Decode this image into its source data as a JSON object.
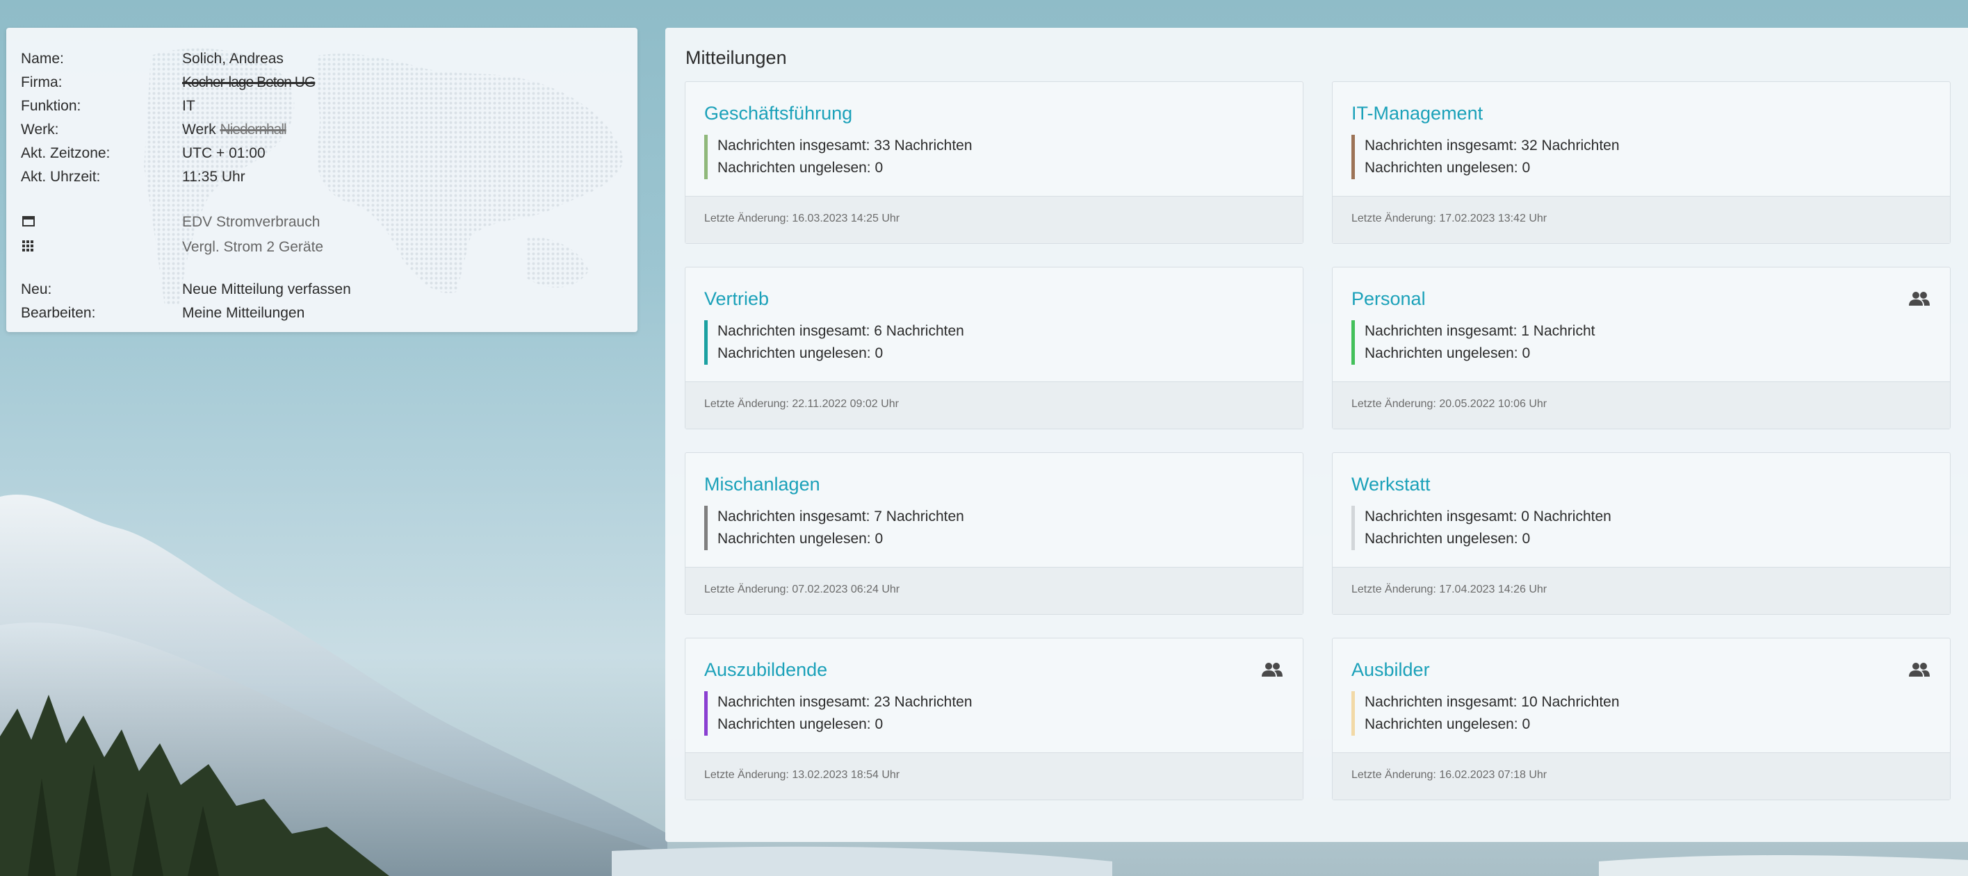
{
  "user_info": {
    "rows": [
      {
        "label": "Name:",
        "value": "Solich, Andreas"
      },
      {
        "label": "Firma:",
        "value": "Kocher-lage Beton UG"
      },
      {
        "label": "Funktion:",
        "value": "IT"
      },
      {
        "label": "Werk:",
        "value": "Werk ",
        "value_redacted": "Niedernhall"
      },
      {
        "label": "Akt. Zeitzone:",
        "value": "UTC + 01:00"
      },
      {
        "label": "Akt. Uhrzeit:",
        "value": "11:35 Uhr"
      }
    ],
    "links": [
      {
        "icon": "calendar-icon",
        "label": "EDV Stromverbrauch"
      },
      {
        "icon": "grid-icon",
        "label": "Vergl. Strom 2 Geräte"
      }
    ],
    "actions": [
      {
        "label": "Neu:",
        "value": "Neue Mitteilung verfassen"
      },
      {
        "label": "Bearbeiten:",
        "value": "Meine Mitteilungen"
      }
    ]
  },
  "main": {
    "title": "Mitteilungen",
    "cards": [
      {
        "title": "Geschäftsführung",
        "total": "Nachrichten insgesamt: 33 Nachrichten",
        "unread": "Nachrichten ungelesen: 0",
        "footer": "Letzte Änderung: 16.03.2023 14:25 Uhr",
        "color": "#8fb87a",
        "group": false
      },
      {
        "title": "IT-Management",
        "total": "Nachrichten insgesamt: 32 Nachrichten",
        "unread": "Nachrichten ungelesen: 0",
        "footer": "Letzte Änderung: 17.02.2023 13:42 Uhr",
        "color": "#9c7356",
        "group": false
      },
      {
        "title": "Vertrieb",
        "total": "Nachrichten insgesamt: 6 Nachrichten",
        "unread": "Nachrichten ungelesen: 0",
        "footer": "Letzte Änderung: 22.11.2022 09:02 Uhr",
        "color": "#1ba1a1",
        "group": false
      },
      {
        "title": "Personal",
        "total": "Nachrichten insgesamt: 1 Nachricht",
        "unread": "Nachrichten ungelesen: 0",
        "footer": "Letzte Änderung: 20.05.2022 10:06 Uhr",
        "color": "#43c05a",
        "group": true
      },
      {
        "title": "Mischanlagen",
        "total": "Nachrichten insgesamt: 7 Nachrichten",
        "unread": "Nachrichten ungelesen: 0",
        "footer": "Letzte Änderung: 07.02.2023 06:24 Uhr",
        "color": "#7f7f7f",
        "group": false
      },
      {
        "title": "Werkstatt",
        "total": "Nachrichten insgesamt: 0 Nachrichten",
        "unread": "Nachrichten ungelesen: 0",
        "footer": "Letzte Änderung: 17.04.2023 14:26 Uhr",
        "color": "#d2d6d9",
        "group": false
      },
      {
        "title": "Auszubildende",
        "total": "Nachrichten insgesamt: 23 Nachrichten",
        "unread": "Nachrichten ungelesen: 0",
        "footer": "Letzte Änderung: 13.02.2023 18:54 Uhr",
        "color": "#8a3fd1",
        "group": true
      },
      {
        "title": "Ausbilder",
        "total": "Nachrichten insgesamt: 10 Nachrichten",
        "unread": "Nachrichten ungelesen: 0",
        "footer": "Letzte Änderung: 16.02.2023 07:18 Uhr",
        "color": "#f2d9a6",
        "group": true
      }
    ]
  }
}
